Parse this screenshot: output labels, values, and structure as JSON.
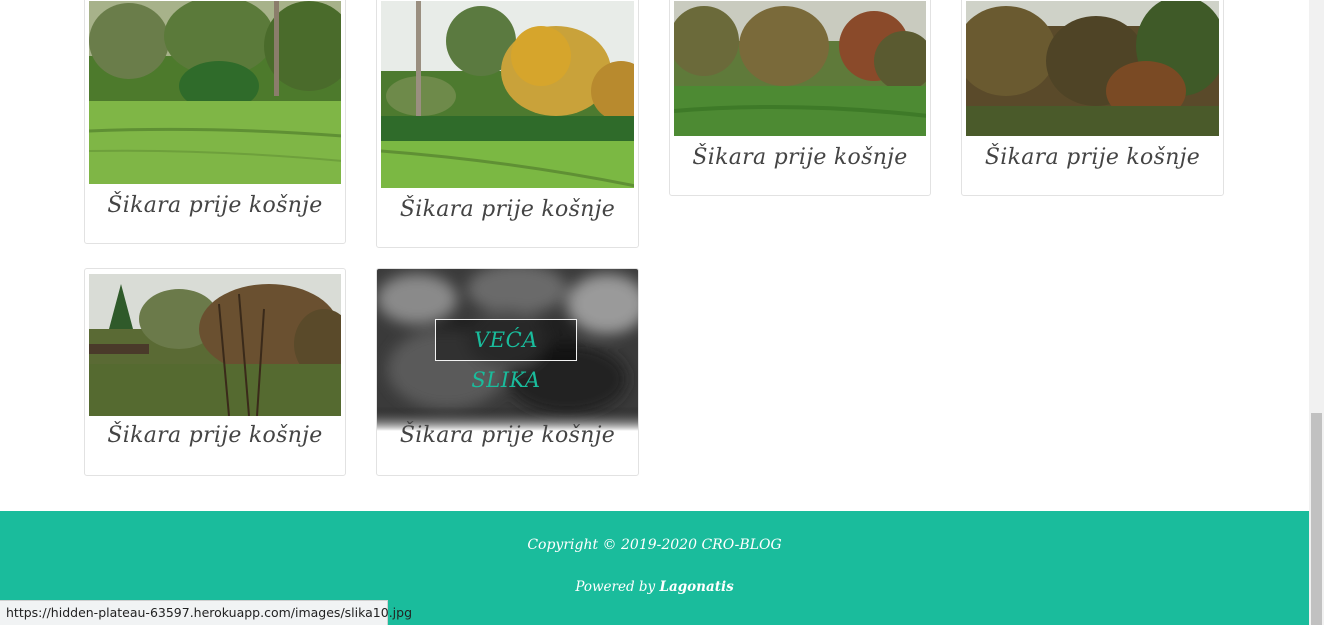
{
  "gallery": {
    "cards": [
      {
        "caption": "Šikara prije košnje"
      },
      {
        "caption": "Šikara prije košnje"
      },
      {
        "caption": "Šikara prije košnje"
      },
      {
        "caption": "Šikara prije košnje"
      },
      {
        "caption": "Šikara prije košnje"
      },
      {
        "caption": "Šikara prije košnje",
        "hover_button": "VEĆA SLIKA"
      }
    ]
  },
  "footer": {
    "copyright": "Copyright © 2019-2020 CRO-BLOG",
    "powered_prefix": "Powered by",
    "powered_name": "Lagonatis"
  },
  "status_bar": {
    "url": "https://hidden-plateau-63597.herokuapp.com/images/slika10.jpg"
  },
  "colors": {
    "accent": "#1abc9c",
    "caption_text": "#444444",
    "card_border": "#e2e2e2"
  }
}
